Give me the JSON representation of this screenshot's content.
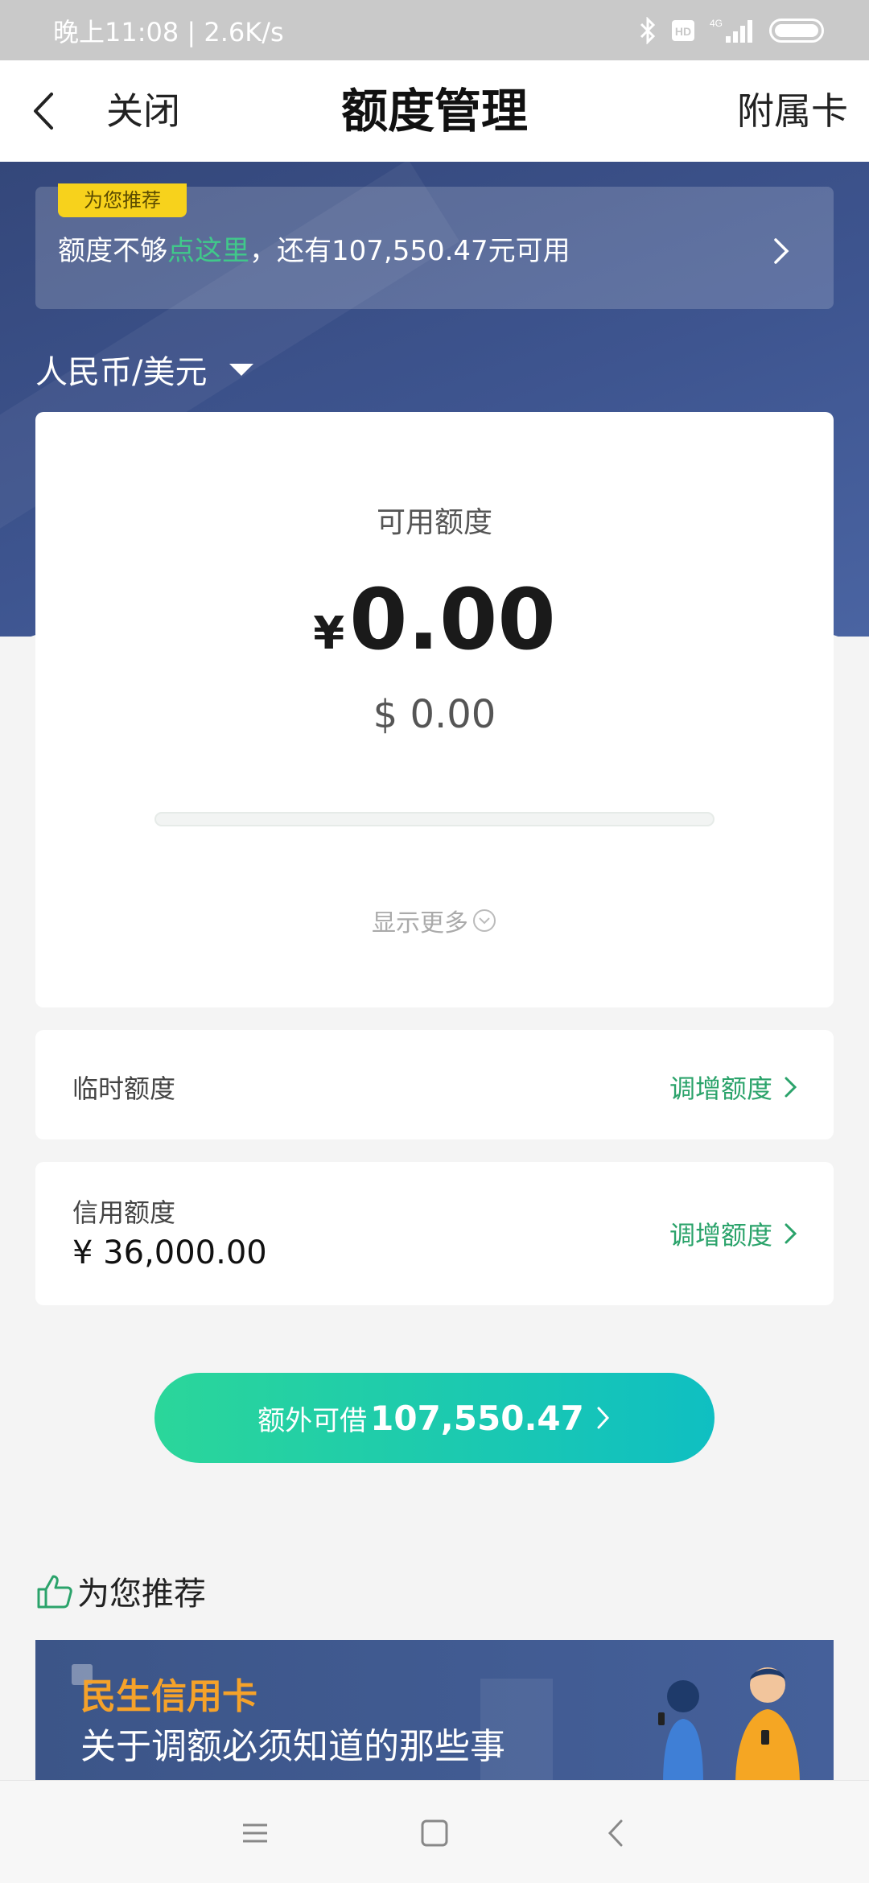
{
  "status_bar": {
    "time_speed": "晚上11:08 | 2.6K/s",
    "network": "4G"
  },
  "nav": {
    "close_label": "关闭",
    "title": "额度管理",
    "supplementary_label": "附属卡"
  },
  "promo": {
    "badge": "为您推荐",
    "text_before": "额度不够",
    "link_text": "点这里",
    "text_after": "，还有107,550.47元可用"
  },
  "currency_selector": {
    "value": "人民币/美元"
  },
  "available": {
    "label": "可用额度",
    "currency_symbol": "¥",
    "amount": "0.00",
    "usd_amount": "$ 0.00",
    "usage_fraction": 0,
    "show_more": "显示更多"
  },
  "temporary_limit": {
    "label": "临时额度",
    "action": "调增额度"
  },
  "credit_limit": {
    "label": "信用额度",
    "value": "¥ 36,000.00",
    "action": "调增额度"
  },
  "borrow_button": {
    "label": "额外可借",
    "amount": "107,550.47"
  },
  "recommend": {
    "title": "为您推荐",
    "banner_title": "民生信用卡",
    "banner_subtitle": "关于调额必须知道的那些事"
  },
  "colors": {
    "accent_green": "#2ba36b",
    "hero_blue": "#3e5590",
    "badge_yellow": "#f7d21c",
    "banner_orange": "#f5a22a"
  }
}
